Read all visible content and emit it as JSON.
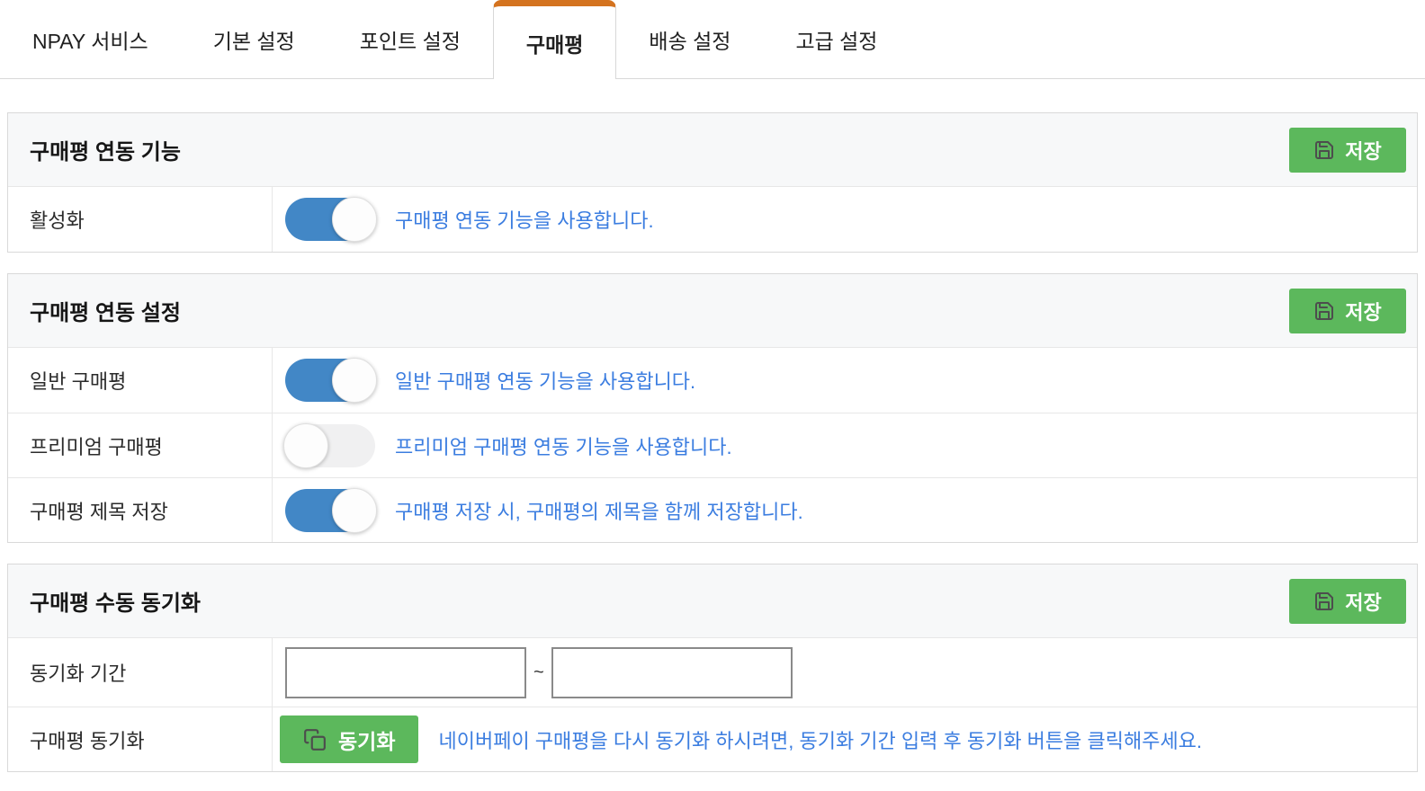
{
  "tabs": {
    "items": [
      {
        "label": "NPAY 서비스",
        "active": false
      },
      {
        "label": "기본 설정",
        "active": false
      },
      {
        "label": "포인트 설정",
        "active": false
      },
      {
        "label": "구매평",
        "active": true
      },
      {
        "label": "배송 설정",
        "active": false
      },
      {
        "label": "고급 설정",
        "active": false
      }
    ]
  },
  "common": {
    "save_label": "저장"
  },
  "sections": [
    {
      "title": "구매평 연동 기능",
      "rows": [
        {
          "label": "활성화",
          "toggle": "on",
          "description": "구매평 연동 기능을 사용합니다."
        }
      ]
    },
    {
      "title": "구매평 연동 설정",
      "rows": [
        {
          "label": "일반 구매평",
          "toggle": "on",
          "description": "일반 구매평 연동 기능을 사용합니다."
        },
        {
          "label": "프리미엄 구매평",
          "toggle": "off",
          "description": "프리미엄 구매평 연동 기능을 사용합니다."
        },
        {
          "label": "구매평 제목 저장",
          "toggle": "on",
          "description": "구매평 저장 시, 구매평의 제목을 함께 저장합니다."
        }
      ]
    },
    {
      "title": "구매평 수동 동기화",
      "rows": [
        {
          "label": "동기화 기간",
          "range": {
            "start_value": "",
            "separator": "~",
            "end_value": ""
          }
        },
        {
          "label": "구매평 동기화",
          "button_label": "동기화",
          "description": "네이버페이 구매평을 다시 동기화 하시려면, 동기화 기간 입력 후 동기화 버튼을 클릭해주세요."
        }
      ]
    }
  ],
  "icons": {
    "save": "floppy-disk-icon",
    "sync": "copy-pages-icon"
  },
  "colors": {
    "active_tab_accent": "#d4731f",
    "toggle_on": "#4287c6",
    "action_green": "#5cb85c",
    "description_blue": "#3b7de0"
  }
}
